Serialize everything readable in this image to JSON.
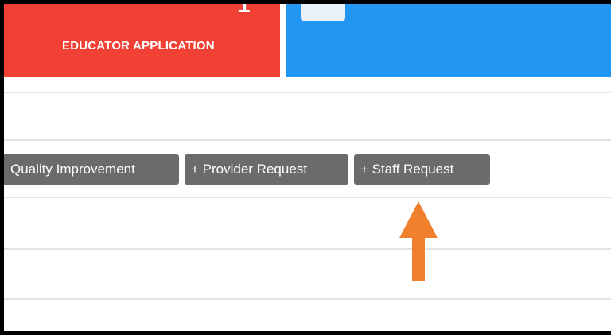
{
  "tiles": {
    "educator_application": {
      "count": "1",
      "label": "EDUCATOR APPLICATION",
      "color": "#f04134"
    },
    "blue_tile": {
      "color": "#2196f3"
    }
  },
  "actions": {
    "quality_improvement": "Quality Improvement",
    "provider_request": "+ Provider Request",
    "staff_request": "+ Staff Request"
  },
  "annotation": {
    "arrow_color": "#f07f2e",
    "arrow_icon": "arrow-up-icon"
  }
}
